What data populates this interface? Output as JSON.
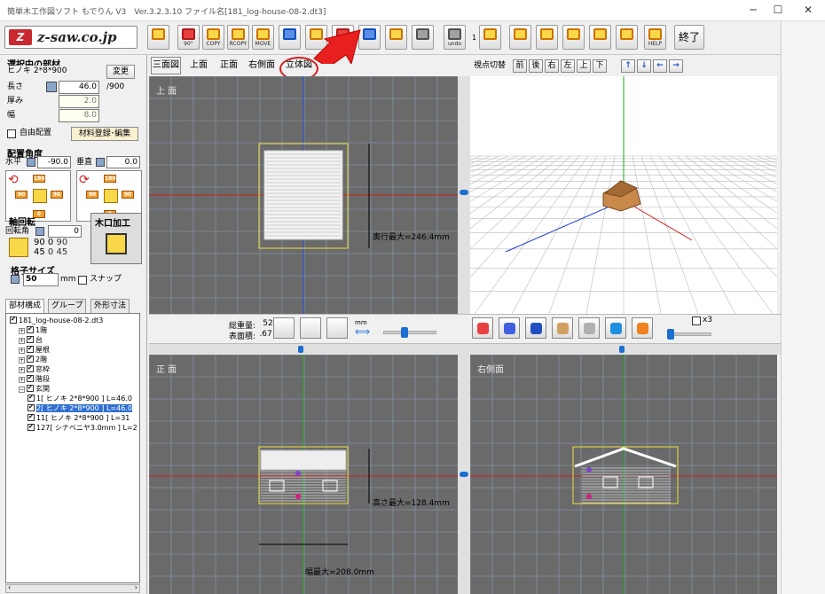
{
  "window": {
    "title": "簡単木工作図ソフト もでりん V3　Ver.3.2.3.10  ファイル名[181_log-house-08-2.dt3]",
    "minimize": "─",
    "maximize": "☐",
    "close": "✕"
  },
  "logo": {
    "mark": "Z",
    "text": "z-saw.co.jp"
  },
  "toolbar": {
    "buttons": [
      {
        "label": ""
      },
      {
        "label": "90°"
      },
      {
        "label": "COPY"
      },
      {
        "label": "RCOPY"
      },
      {
        "label": "MOVE"
      },
      {
        "label": ""
      },
      {
        "label": ""
      },
      {
        "label": ""
      },
      {
        "label": ""
      },
      {
        "label": ""
      },
      {
        "label": ""
      },
      {
        "label": "undo"
      },
      {
        "label": ""
      },
      {
        "label": ""
      },
      {
        "label": ""
      },
      {
        "label": ""
      },
      {
        "label": ""
      },
      {
        "label": ""
      },
      {
        "label": "HELP"
      }
    ],
    "counter": "1",
    "exit_label": "終了"
  },
  "material": {
    "section_title": "選択中の部材",
    "name": "ヒノキ 2*8*900",
    "change_label": "変更",
    "length_label": "長さ",
    "length_value": "46.0",
    "length_max": "/900",
    "thickness_label": "厚み",
    "thickness_value": "2.0",
    "width_label": "幅",
    "width_value": "8.0",
    "free_place_label": "自由配置",
    "register_label": "材料登録･編集"
  },
  "angle": {
    "section_title": "配置角度",
    "horizontal_label": "水平",
    "horizontal_value": "-90.0",
    "vertical_label": "垂直",
    "vertical_value": "0.0",
    "cells_h": [
      "180",
      "90",
      "90",
      "0"
    ],
    "cells_v": [
      "180",
      "90",
      "90",
      "0"
    ]
  },
  "axis_rotation": {
    "section_title": "軸回転",
    "rotation_label": "回転角",
    "rotation_value": "0",
    "cells": [
      "90",
      "0",
      "90",
      "45",
      "0",
      "45"
    ]
  },
  "mouth": {
    "section_title": "木口加工"
  },
  "grid": {
    "section_title": "格子サイズ",
    "size_value": "50",
    "unit": "mm",
    "snap_label": "スナップ"
  },
  "left_tabs": [
    "部材構成",
    "グループ",
    "外形寸法"
  ],
  "tree": [
    {
      "label": "181_log-house-08-2.dt3",
      "level": 0,
      "expander": ""
    },
    {
      "label": "1階",
      "level": 1,
      "expander": "+"
    },
    {
      "label": "台",
      "level": 1,
      "expander": "+"
    },
    {
      "label": "屋根",
      "level": 1,
      "expander": "+"
    },
    {
      "label": "2階",
      "level": 1,
      "expander": "+"
    },
    {
      "label": "窓枠",
      "level": 1,
      "expander": "+"
    },
    {
      "label": "階段",
      "level": 1,
      "expander": "+"
    },
    {
      "label": "玄関",
      "level": 1,
      "expander": "−"
    },
    {
      "label": "1[ ヒノキ 2*8*900 ] L=46.0",
      "level": 2,
      "expander": ""
    },
    {
      "label": "2[ ヒノキ 2*8*900 ] L=46.0",
      "level": 2,
      "expander": ""
    },
    {
      "label": "11[ ヒノキ 2*8*900 ] L=31",
      "level": 2,
      "expander": ""
    },
    {
      "label": "127[ シナベニヤ3.0mm ] L=2",
      "level": 2,
      "expander": ""
    }
  ],
  "view_tabs": [
    "三面図",
    "上面",
    "正面",
    "右側面",
    "立体図"
  ],
  "viewpoint": {
    "label": "視点切替",
    "buttons": [
      "前",
      "後",
      "右",
      "左",
      "上",
      "下"
    ],
    "arrows": [
      "↑",
      "↓",
      "←",
      "→"
    ]
  },
  "panes": {
    "top": {
      "label": "上 面",
      "dimension": "奥行最大=246.4mm"
    },
    "front": {
      "label": "正 面",
      "dimension_h": "高さ最大=128.4mm",
      "dimension_w": "幅最大=208.0mm"
    },
    "side": {
      "label": "右側面"
    }
  },
  "stats": {
    "weight_label": "総重量:",
    "weight_value": "520 g",
    "area_label": "表面積:",
    "area_value": ".67 m²",
    "mm_label": "mm"
  },
  "zoom_label": "x3",
  "colors": {
    "pane_bg": "#6a6a6a",
    "grid_line": "#8aa0b8",
    "axis_red": "#d02020",
    "axis_blue": "#2040d0",
    "axis_green": "#20a020",
    "model_outline": "#f0e040",
    "highlight": "#d02020"
  }
}
